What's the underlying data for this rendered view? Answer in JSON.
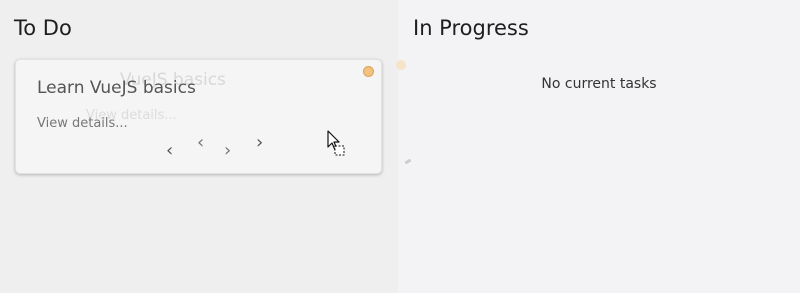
{
  "columns": {
    "todo": {
      "title": "To Do",
      "card": {
        "title": "Learn VueJS basics",
        "details_link": "View details...",
        "ghost_title": "VueJS basics",
        "ghost_details": "View details...",
        "status_color": "#f2c27e",
        "nav": {
          "left": "‹",
          "left2": "‹",
          "right2": "›",
          "right": "›"
        }
      }
    },
    "in_progress": {
      "title": "In Progress",
      "empty_message": "No current tasks"
    }
  },
  "cursor": {
    "icon": "drag-copy-cursor-icon"
  }
}
